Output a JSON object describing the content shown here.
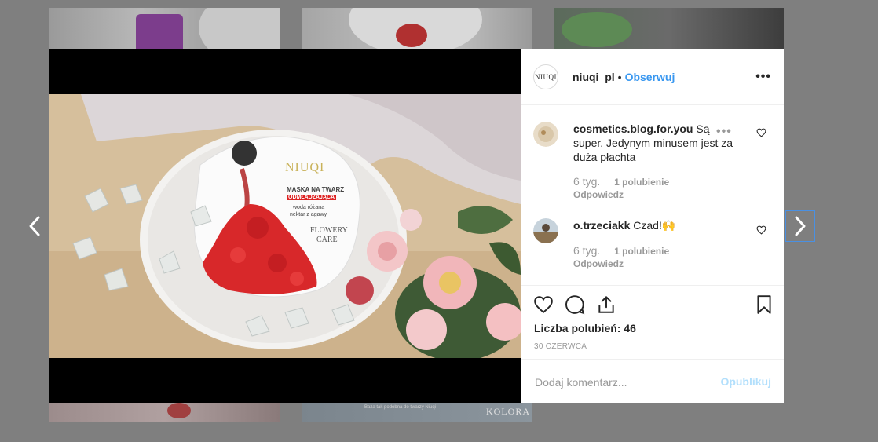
{
  "modal": {
    "post": {
      "header": {
        "avatar_text": "NIUQI",
        "username": "niuqi_pl",
        "separator": "•",
        "follow_label": "Obserwuj",
        "more_label": "•••"
      },
      "photo": {
        "mask_brand": "NIUQI",
        "mask_title": "MASKA NA TWARZ",
        "mask_badge": "ODMŁADZAJĄCA",
        "mask_desc_1": "woda różana",
        "mask_desc_2": "nektar z agawy",
        "mask_line_1": "FLOWERY",
        "mask_line_2": "CARE"
      },
      "comments": [
        {
          "username": "cosmetics.blog.for.you",
          "text": "Są super. Jedynym minusem jest za duża płachta",
          "time": "6 tyg.",
          "likes": "1 polubienie",
          "reply_label": "Odpowiedz",
          "more_label": "•••"
        },
        {
          "username": "o.trzeciakk",
          "text": "Czad!🙌",
          "time": "6 tyg.",
          "likes": "1 polubienie",
          "reply_label": "Odpowiedz"
        }
      ],
      "likes_label": "Liczba polubień: 46",
      "date": "30 CZERWCA",
      "add_comment": {
        "placeholder": "Dodaj komentarz...",
        "publish_label": "Opublikuj"
      }
    }
  },
  "background_tiles": {
    "bottom_caption": "Baza tak podobna do twarzy Niuqi",
    "bottom_right_text": "KOLORA"
  },
  "colors": {
    "follow": "#3897f0",
    "publish_disabled": "#b2dffc",
    "overlay": "#7f7f7f",
    "next_focus": "#4a90e2"
  }
}
